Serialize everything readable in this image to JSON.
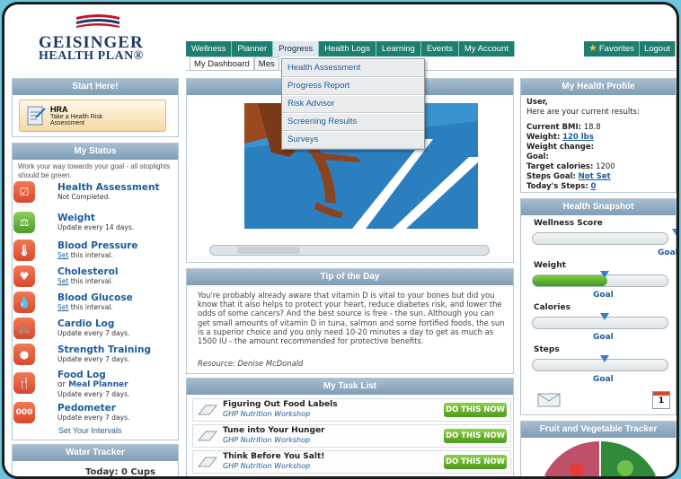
{
  "brand": {
    "line1": "GEISINGER",
    "line2": "HEALTH PLAN®"
  },
  "nav": {
    "tabs": [
      "Wellness",
      "Planner",
      "Progress",
      "Health Logs",
      "Learning",
      "Events",
      "My Account"
    ],
    "favorites": "Favorites",
    "logout": "Logout"
  },
  "subtabs": [
    "My Dashboard",
    "Mes"
  ],
  "progress_menu": [
    "Health Assessment",
    "Progress Report",
    "Risk Advisor",
    "Screening Results",
    "Surveys"
  ],
  "start_here": {
    "title": "Start Here!",
    "hra_title": "HRA",
    "hra_sub1": "Take a Health Risk",
    "hra_sub2": "Assessment"
  },
  "my_status": {
    "title": "My Status",
    "intro": "Work your way towards your goal - all stoplights should be green.",
    "items": [
      {
        "title": "Health Assessment",
        "sub": "Not Completed.",
        "icon": "checklist-icon"
      },
      {
        "title": "Weight",
        "sub": "Update every 14 days.",
        "icon": "scale-icon"
      },
      {
        "title": "Blood Pressure",
        "sub_link": "Set",
        "sub": " this interval.",
        "icon": "thermometer-icon"
      },
      {
        "title": "Cholesterol",
        "sub_link": "Set",
        "sub": " this interval.",
        "icon": "heart-icon"
      },
      {
        "title": "Blood Glucose",
        "sub_link": "Set",
        "sub": " this interval.",
        "icon": "drop-icon"
      },
      {
        "title": "Cardio Log",
        "sub": "Update every 7 days.",
        "icon": "bicycle-icon"
      },
      {
        "title": "Strength Training",
        "sub": "Update every 7 days.",
        "icon": "dumbbell-icon"
      },
      {
        "title": "Food Log",
        "title2_prefix": "or ",
        "title2": "Meal Planner",
        "sub": "Update every 7 days.",
        "icon": "food-icon"
      },
      {
        "title": "Pedometer",
        "sub": "Update every 7 days.",
        "icon": "pedometer-icon"
      }
    ],
    "set_intervals": "Set Your Intervals"
  },
  "water_tracker": {
    "title": "Water Tracker",
    "today": "Today: 0 Cups"
  },
  "tip": {
    "title": "Tip of the Day",
    "text": "You're probably already aware that vitamin D is vital to your bones but did you know that it also helps to protect your heart, reduce diabetes risk, and lower the odds of some cancers? And the best source is free - the sun. Although you can get small amounts of vitamin D in tuna, salmon and some fortified foods, the sun is a superior choice and you only need 10-20 minutes a day to get as much as 1500 IU - the amount recommended for protective benefits.",
    "resource": "Resource: Denise McDonald"
  },
  "tasks": {
    "title": "My Task List",
    "items": [
      {
        "title": "Figuring Out Food Labels",
        "sub": "GHP Nutrition Workshop",
        "button": "DO THIS NOW"
      },
      {
        "title": "Tune into Your Hunger",
        "sub": "GHP Nutrition Workshop",
        "button": "DO THIS NOW"
      },
      {
        "title": "Think Before You Salt!",
        "sub": "GHP Nutrition Workshop",
        "button": "DO THIS NOW"
      }
    ]
  },
  "profile": {
    "title": "My Health Profile",
    "greeting": "User,",
    "intro": "Here are your current results:",
    "bmi_label": "Current BMI:",
    "bmi": "18.8",
    "weight_label": "Weight:",
    "weight": "120 lbs",
    "weight_change_label": "Weight change:",
    "goal_label": "Goal:",
    "target_label": "Target calories:",
    "target": "1200",
    "steps_goal_label": "Steps Goal:",
    "steps_goal": "Not Set",
    "today_steps_label": "Today's Steps:",
    "today_steps": "0"
  },
  "snapshot": {
    "title": "Health Snapshot",
    "items": [
      {
        "label": "Wellness Score",
        "goal": "Goal",
        "fill": 0
      },
      {
        "label": "Weight",
        "goal": "Goal",
        "fill": 0.55
      },
      {
        "label": "Calories",
        "goal": "Goal",
        "fill": 0
      },
      {
        "label": "Steps",
        "goal": "Goal",
        "fill": 0
      }
    ],
    "calendar_day": "1"
  },
  "fruit_veg": {
    "title": "Fruit and Vegetable Tracker"
  },
  "colors": {
    "nav": "#1d7f6f",
    "panel_head": "#8ea9c0",
    "link": "#1c5c9c",
    "green_button": "#5aab27",
    "alert": "#e0552f"
  }
}
